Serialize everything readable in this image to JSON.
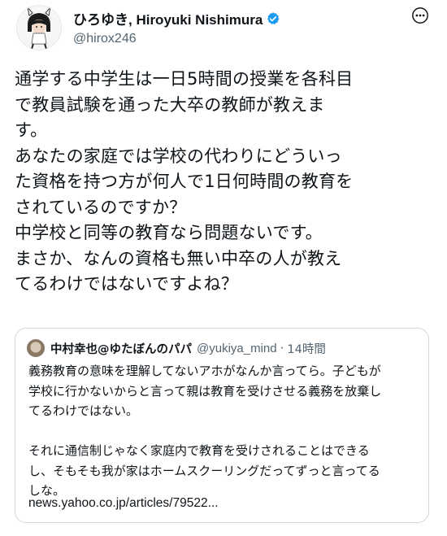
{
  "author": {
    "display_name": "ひろゆき, Hiroyuki Nishimura",
    "handle": "@hirox246",
    "verified_icon": "verified-badge-icon"
  },
  "tweet": {
    "text": "通学する中学生は一日5時間の授業を各科目\nで教員試験を通った大卒の教師が教えま\nす。\nあなたの家庭では学校の代わりにどういっ\nた資格を持つ方が何人で1日何時間の教育を\nされているのですか？\n中学校と同等の教育なら問題ないです。\nまさか、なんの資格も無い中卒の人が教え\nてるわけではないですよね？"
  },
  "quoted_tweet": {
    "display_name": "中村幸也@ゆたぼんのパパ",
    "handle": "@yukiya_mind",
    "separator": "·",
    "time": "14時間",
    "text": "義務教育の意味を理解してないアホがなんか言ってら。子どもが\n学校に行かないからと言って親は教育を受けさせる義務を放棄し\nてるわけではない。\n\nそれに通信制じゃなく家庭内で教育を受けされることはできる\nし、そもそも我が家はホームスクーリングだってずっと言ってる\nしな。",
    "link": "news.yahoo.co.jp/articles/79522..."
  },
  "colors": {
    "text": "#0f1419",
    "secondary": "#536471",
    "verified": "#1d9bf0",
    "border": "#cfd9de"
  }
}
